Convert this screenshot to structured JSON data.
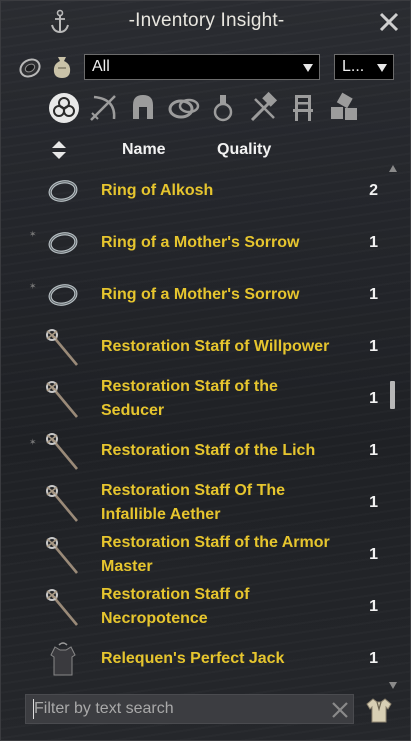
{
  "window": {
    "title": "-Inventory Insight-",
    "anchor_icon": "anchor-icon",
    "close_icon": "close-icon"
  },
  "filters": {
    "bag_filter": {
      "selected": "All"
    },
    "secondary_filter": {
      "selected": "L..."
    }
  },
  "tabs": [
    {
      "id": "all",
      "icon": "all-items-icon",
      "selected": true
    },
    {
      "id": "weapons",
      "icon": "crossed-weapons-icon"
    },
    {
      "id": "armor",
      "icon": "helmet-icon"
    },
    {
      "id": "jewelry",
      "icon": "jewelry-icon"
    },
    {
      "id": "consumables",
      "icon": "potion-icon"
    },
    {
      "id": "materials",
      "icon": "hammer-tools-icon"
    },
    {
      "id": "furnishings",
      "icon": "chair-icon"
    },
    {
      "id": "misc",
      "icon": "boxes-icon"
    }
  ],
  "table": {
    "headers": {
      "name": "Name",
      "quality": "Quality"
    },
    "rows": [
      {
        "name": "Ring of Alkosh",
        "count": "2",
        "icon": "ring-icon",
        "marked": false
      },
      {
        "name": "Ring of a Mother's Sorrow",
        "count": "1",
        "icon": "ring-icon",
        "marked": true
      },
      {
        "name": "Ring of a Mother's Sorrow",
        "count": "1",
        "icon": "ring-icon",
        "marked": true
      },
      {
        "name": "Restoration Staff of Willpower",
        "count": "1",
        "icon": "staff-icon",
        "marked": false
      },
      {
        "name": "Restoration Staff of the Seducer",
        "count": "1",
        "icon": "staff-icon",
        "marked": false
      },
      {
        "name": "Restoration Staff of the Lich",
        "count": "1",
        "icon": "staff-icon",
        "marked": true
      },
      {
        "name": "Restoration Staff Of The Infallible Aether",
        "count": "1",
        "icon": "staff-icon",
        "marked": false
      },
      {
        "name": "Restoration Staff of the Armor Master",
        "count": "1",
        "icon": "staff-icon",
        "marked": false
      },
      {
        "name": "Restoration Staff of Necropotence",
        "count": "1",
        "icon": "staff-icon",
        "marked": false
      },
      {
        "name": "Relequen's Perfect Jack",
        "count": "1",
        "icon": "jack-armor-icon",
        "marked": false
      }
    ]
  },
  "search": {
    "placeholder": "Filter by text search",
    "value": ""
  },
  "colors": {
    "item_name": "#e6c52e",
    "text": "#f2f2f2",
    "panel_bg": "#24262b"
  }
}
